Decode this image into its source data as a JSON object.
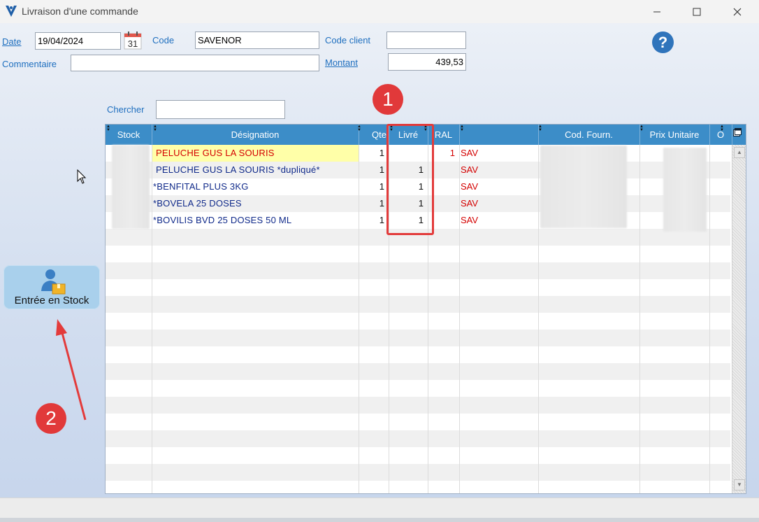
{
  "window": {
    "title": "Livraison d'une commande"
  },
  "form": {
    "date_label": "Date",
    "date_value": "19/04/2024",
    "calendar_day": "31",
    "code_label": "Code",
    "code_value": "SAVENOR",
    "code_client_label": "Code client",
    "code_client_value": "",
    "commentaire_label": "Commentaire",
    "commentaire_value": "",
    "montant_label": "Montant",
    "montant_value": "439,53",
    "help_glyph": "?"
  },
  "search": {
    "label": "Chercher",
    "value": ""
  },
  "grid": {
    "columns": [
      "Stock",
      "Désignation",
      "Qte",
      "Livré",
      "RAL",
      "",
      "Cod. Fourn.",
      "Prix Unitaire",
      "O"
    ],
    "rows": [
      {
        "designation": "PELUCHE GUS LA SOURIS",
        "qte": "1",
        "livre": "",
        "ral": "1",
        "status": "SAV",
        "highlighted": true
      },
      {
        "designation": "PELUCHE GUS LA SOURIS *dupliqué*",
        "qte": "1",
        "livre": "1",
        "ral": "",
        "status": "SAV",
        "highlighted": false
      },
      {
        "designation": "*BENFITAL PLUS 3KG",
        "qte": "1",
        "livre": "1",
        "ral": "",
        "status": "SAV",
        "highlighted": false
      },
      {
        "designation": "*BOVELA 25 DOSES",
        "qte": "1",
        "livre": "1",
        "ral": "",
        "status": "SAV",
        "highlighted": false
      },
      {
        "designation": "*BOVILIS BVD 25 DOSES  50 ML",
        "qte": "1",
        "livre": "1",
        "ral": "",
        "status": "SAV",
        "highlighted": false
      }
    ]
  },
  "actions": {
    "stock_entry_label": "Entrée en Stock"
  },
  "annotations": {
    "marker_1": "1",
    "marker_2": "2"
  },
  "colors": {
    "accent": "#3c8dc8",
    "link": "#1f6fbf",
    "annotation": "#e1393a",
    "sav_text": "#d40000",
    "highlight_row": "#ffffa8"
  },
  "icons": [
    "app-logo-icon",
    "minimize-icon",
    "maximize-icon",
    "close-icon",
    "calendar-icon",
    "help-icon",
    "column-config-icon",
    "scroll-up-icon",
    "scroll-down-icon",
    "stock-entry-icon",
    "mouse-cursor-icon"
  ]
}
